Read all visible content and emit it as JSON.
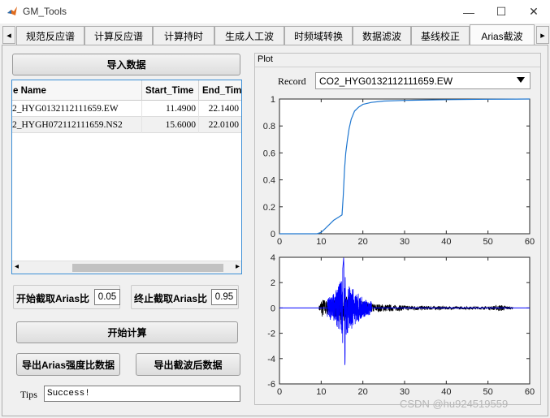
{
  "window": {
    "title": "GM_Tools",
    "minimize_glyph": "—",
    "maximize_glyph": "☐",
    "close_glyph": "✕"
  },
  "tabs": {
    "left_arrow": "◂",
    "right_arrow": "▸",
    "items": [
      "规范反应谱",
      "计算反应谱",
      "计算持时",
      "生成人工波",
      "时频域转换",
      "数据滤波",
      "基线校正",
      "Arias截波"
    ],
    "active": "Arias截波"
  },
  "left": {
    "import_button": "导入数据",
    "table": {
      "columns": [
        "e Name",
        "Start_Time",
        "End_Time"
      ],
      "rows": [
        [
          "2_HYG0132112111659.EW",
          "11.4900",
          "22.1400"
        ],
        [
          "2_HYGH072112111659.NS2",
          "15.6000",
          "22.0100"
        ]
      ],
      "scroll_left": "◂",
      "scroll_right": "▸"
    },
    "start_ratio_label": "开始截取Arias比",
    "start_ratio_value": "0.05",
    "end_ratio_label": "终止截取Arias比",
    "end_ratio_value": "0.95",
    "compute_button": "开始计算",
    "export_arias_button": "导出Arias强度比数据",
    "export_cut_button": "导出截波后数据",
    "tips_label": "Tips",
    "tips_value": "Success!"
  },
  "plot": {
    "panel_title": "Plot",
    "record_label": "Record",
    "record_value": "CO2_HYG0132112111659.EW"
  },
  "chart_data": [
    {
      "type": "line",
      "title": "",
      "xlabel": "",
      "ylabel": "",
      "xlim": [
        0,
        60
      ],
      "ylim": [
        0,
        1
      ],
      "xticks": [
        "0",
        "10",
        "20",
        "30",
        "40",
        "50",
        "60"
      ],
      "yticks": [
        "0",
        "0.2",
        "0.4",
        "0.6",
        "0.8",
        "1"
      ],
      "grid": false,
      "color": "#1f77d0",
      "series": [
        {
          "x": [
            0,
            9,
            10,
            11,
            12,
            13,
            14,
            15,
            15.3,
            15.6,
            15.9,
            16.3,
            16.7,
            17.2,
            18,
            19,
            20,
            22,
            25,
            30,
            40,
            50,
            60
          ],
          "y": [
            0,
            0,
            0.01,
            0.04,
            0.07,
            0.1,
            0.12,
            0.14,
            0.28,
            0.48,
            0.6,
            0.7,
            0.78,
            0.85,
            0.91,
            0.94,
            0.96,
            0.975,
            0.985,
            0.99,
            0.995,
            0.998,
            1.0
          ]
        }
      ]
    },
    {
      "type": "line",
      "title": "",
      "xlabel": "",
      "ylabel": "",
      "xlim": [
        0,
        60
      ],
      "ylim": [
        -6,
        4
      ],
      "xticks": [
        "0",
        "10",
        "20",
        "30",
        "40",
        "50",
        "60"
      ],
      "yticks": [
        "-6",
        "-4",
        "-2",
        "0",
        "2",
        "4"
      ],
      "grid": false,
      "series": [
        {
          "name": "",
          "color": "#000000",
          "x_range": [
            9.5,
            56
          ],
          "envelope": [
            [
              9.5,
              0.15
            ],
            [
              10,
              0.8
            ],
            [
              12,
              0.5
            ],
            [
              15,
              1.3
            ],
            [
              16,
              0.9
            ],
            [
              18,
              0.7
            ],
            [
              22,
              0.35
            ],
            [
              30,
              0.2
            ],
            [
              40,
              0.12
            ],
            [
              50,
              0.1
            ],
            [
              53,
              0.25
            ],
            [
              56,
              0.05
            ]
          ]
        },
        {
          "name": "",
          "color": "#0000ff",
          "x_range": [
            0,
            60
          ],
          "flat_value": 0,
          "active_x_range": [
            11.49,
            22.14
          ],
          "envelope": [
            [
              11.49,
              0.7
            ],
            [
              13,
              1.2
            ],
            [
              14,
              1.6
            ],
            [
              15,
              2.4
            ],
            [
              15.4,
              4.0
            ],
            [
              15.7,
              -4.8
            ],
            [
              16,
              2.5
            ],
            [
              17,
              1.8
            ],
            [
              18.5,
              1.2
            ],
            [
              20,
              0.8
            ],
            [
              22.14,
              0.5
            ]
          ]
        }
      ]
    }
  ],
  "watermark": "CSDN @hu924519559",
  "colors": {
    "tab_border": "#adadad",
    "table_border": "#3c8fd6",
    "cdf_line": "#1f77d0",
    "waveform_full": "#000000",
    "waveform_cut": "#0000ff"
  }
}
